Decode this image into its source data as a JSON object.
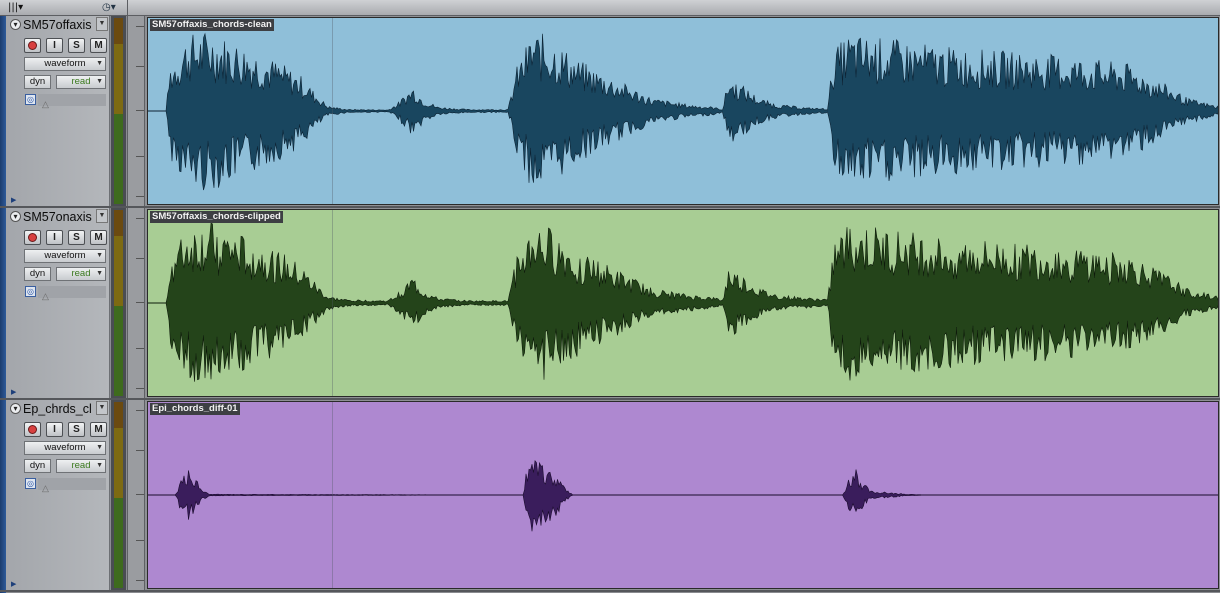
{
  "toolbar": {
    "view_icon": "columns-icon",
    "view_glyph": "|||▾",
    "clock_glyph": "◷▾"
  },
  "tracks": [
    {
      "name": "SM57offaxis",
      "view": "waveform",
      "dyn": "dyn",
      "automation": "read",
      "clip_name": "SM57offaxis_chords-clean",
      "clip_color": "#8fbfd9",
      "wave_color": "#19465f",
      "wave_stroke": "#0c2233",
      "envelope": [
        [
          0,
          0
        ],
        [
          18,
          0
        ],
        [
          22,
          0.55
        ],
        [
          40,
          0.9
        ],
        [
          60,
          0.95
        ],
        [
          80,
          0.85
        ],
        [
          110,
          0.7
        ],
        [
          135,
          0.55
        ],
        [
          155,
          0.4
        ],
        [
          165,
          0.25
        ],
        [
          180,
          0.06
        ],
        [
          200,
          0.02
        ],
        [
          240,
          0.015
        ],
        [
          250,
          0.1
        ],
        [
          265,
          0.3
        ],
        [
          275,
          0.15
        ],
        [
          290,
          0.05
        ],
        [
          320,
          0.02
        ],
        [
          360,
          0.02
        ],
        [
          368,
          0.5
        ],
        [
          385,
          0.95
        ],
        [
          405,
          0.85
        ],
        [
          430,
          0.6
        ],
        [
          455,
          0.45
        ],
        [
          480,
          0.3
        ],
        [
          505,
          0.15
        ],
        [
          540,
          0.08
        ],
        [
          565,
          0.05
        ],
        [
          575,
          0.02
        ],
        [
          580,
          0.4
        ],
        [
          595,
          0.3
        ],
        [
          612,
          0.15
        ],
        [
          630,
          0.08
        ],
        [
          660,
          0.04
        ],
        [
          680,
          0.03
        ],
        [
          685,
          0.7
        ],
        [
          700,
          0.9
        ],
        [
          740,
          0.85
        ],
        [
          800,
          0.75
        ],
        [
          860,
          0.7
        ],
        [
          920,
          0.65
        ],
        [
          980,
          0.55
        ],
        [
          1020,
          0.3
        ],
        [
          1040,
          0.15
        ],
        [
          1070,
          0.06
        ]
      ]
    },
    {
      "name": "SM57onaxis",
      "view": "waveform",
      "dyn": "dyn",
      "automation": "read",
      "clip_name": "SM57offaxis_chords-clipped",
      "clip_color": "#a8cd94",
      "wave_color": "#24441a",
      "wave_stroke": "#0d1a0a",
      "envelope": [
        [
          0,
          0
        ],
        [
          18,
          0
        ],
        [
          22,
          0.55
        ],
        [
          40,
          0.9
        ],
        [
          60,
          0.95
        ],
        [
          80,
          0.85
        ],
        [
          110,
          0.72
        ],
        [
          135,
          0.58
        ],
        [
          155,
          0.42
        ],
        [
          165,
          0.28
        ],
        [
          180,
          0.08
        ],
        [
          200,
          0.04
        ],
        [
          240,
          0.03
        ],
        [
          250,
          0.12
        ],
        [
          265,
          0.32
        ],
        [
          275,
          0.16
        ],
        [
          290,
          0.06
        ],
        [
          320,
          0.03
        ],
        [
          360,
          0.03
        ],
        [
          368,
          0.52
        ],
        [
          385,
          0.95
        ],
        [
          405,
          0.86
        ],
        [
          430,
          0.62
        ],
        [
          455,
          0.47
        ],
        [
          480,
          0.32
        ],
        [
          505,
          0.17
        ],
        [
          540,
          0.1
        ],
        [
          565,
          0.07
        ],
        [
          575,
          0.04
        ],
        [
          580,
          0.42
        ],
        [
          595,
          0.32
        ],
        [
          612,
          0.17
        ],
        [
          630,
          0.1
        ],
        [
          660,
          0.06
        ],
        [
          680,
          0.05
        ],
        [
          685,
          0.72
        ],
        [
          700,
          0.92
        ],
        [
          740,
          0.86
        ],
        [
          800,
          0.76
        ],
        [
          860,
          0.71
        ],
        [
          920,
          0.66
        ],
        [
          980,
          0.57
        ],
        [
          1020,
          0.32
        ],
        [
          1040,
          0.17
        ],
        [
          1070,
          0.08
        ]
      ]
    },
    {
      "name": "Ep_chrds_cl",
      "view": "waveform",
      "dyn": "dyn",
      "automation": "read",
      "clip_name": "Epi_chords_diff-01",
      "clip_color": "#ae88d0",
      "wave_color": "#3a1d5c",
      "wave_stroke": "#1a0c2c",
      "envelope": [
        [
          0,
          0
        ],
        [
          28,
          0
        ],
        [
          32,
          0.2
        ],
        [
          40,
          0.3
        ],
        [
          48,
          0.2
        ],
        [
          56,
          0.05
        ],
        [
          62,
          0.01
        ],
        [
          375,
          0
        ],
        [
          378,
          0.3
        ],
        [
          385,
          0.45
        ],
        [
          395,
          0.35
        ],
        [
          410,
          0.25
        ],
        [
          420,
          0.05
        ],
        [
          425,
          0
        ],
        [
          695,
          0
        ],
        [
          700,
          0.2
        ],
        [
          708,
          0.3
        ],
        [
          716,
          0.15
        ],
        [
          722,
          0.05
        ],
        [
          760,
          0.01
        ],
        [
          780,
          0
        ]
      ]
    }
  ]
}
